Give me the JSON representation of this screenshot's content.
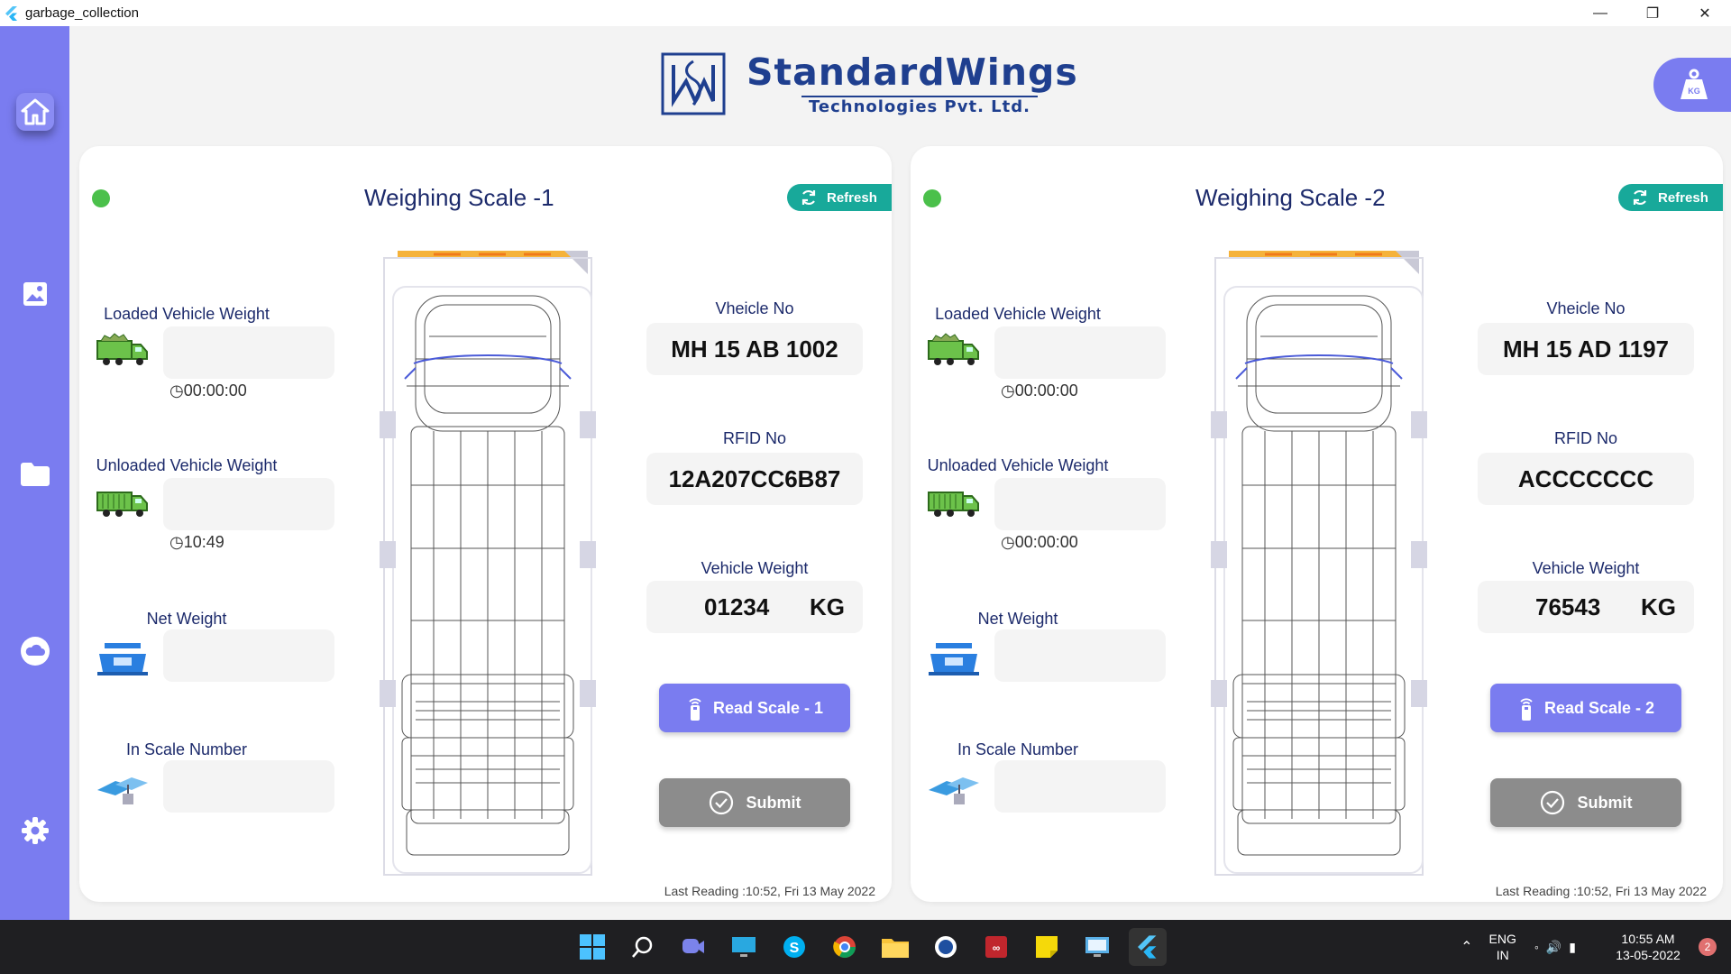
{
  "window": {
    "title": "garbage_collection"
  },
  "brand": {
    "name": "StandardWings",
    "subtitle": "Technologies Pvt. Ltd."
  },
  "sidebar": {
    "items": [
      "home-icon",
      "image-icon",
      "folder-icon",
      "cloud-icon",
      "settings-icon"
    ]
  },
  "panels": [
    {
      "title": "Weighing Scale -1",
      "refresh_label": "Refresh",
      "status_color": "#4bc04b",
      "loaded_label": "Loaded Vehicle Weight",
      "loaded_time": "00:00:00",
      "unloaded_label": "Unloaded Vehicle Weight",
      "unloaded_time": "10:49",
      "net_label": "Net Weight",
      "inscale_label": "In Scale Number",
      "vehicle_no_label": "Vheicle No",
      "vehicle_no": "MH 15 AB 1002",
      "rfid_label": "RFID No",
      "rfid": "12A207CC6B87",
      "weight_label": "Vehicle Weight",
      "weight": "01234",
      "weight_unit": "KG",
      "read_label": "Read Scale - 1",
      "submit_label": "Submit",
      "last_reading": "Last Reading :10:52, Fri 13 May 2022"
    },
    {
      "title": "Weighing Scale -2",
      "refresh_label": "Refresh",
      "status_color": "#4bc04b",
      "loaded_label": "Loaded Vehicle Weight",
      "loaded_time": "00:00:00",
      "unloaded_label": "Unloaded Vehicle Weight",
      "unloaded_time": "00:00:00",
      "net_label": "Net Weight",
      "inscale_label": "In Scale Number",
      "vehicle_no_label": "Vheicle No",
      "vehicle_no": "MH 15 AD 1197",
      "rfid_label": "RFID No",
      "rfid": "ACCCCCCC",
      "weight_label": "Vehicle Weight",
      "weight": "76543",
      "weight_unit": "KG",
      "read_label": "Read Scale - 2",
      "submit_label": "Submit",
      "last_reading": "Last Reading :10:52, Fri 13 May 2022"
    }
  ],
  "taskbar": {
    "lang": "ENG",
    "region": "IN",
    "time": "10:55 AM",
    "date": "13-05-2022",
    "badge": "2"
  },
  "colors": {
    "accent": "#7a7cf0",
    "refresh": "#18a99a",
    "submit": "#8c8c8c",
    "brand": "#1f3f8f"
  }
}
